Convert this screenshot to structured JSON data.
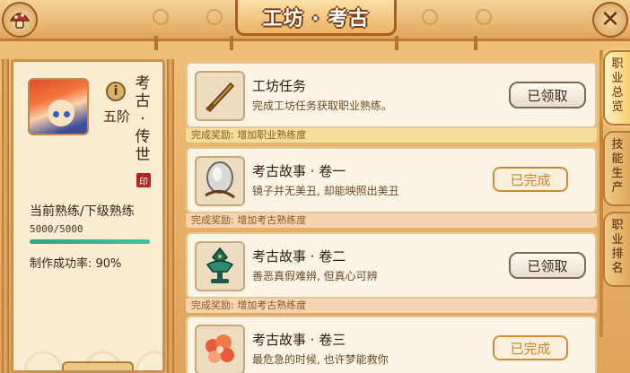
{
  "header": {
    "title": "工坊 · 考古",
    "close_icon": "close-icon",
    "home_icon": "mushroom-home-icon"
  },
  "profile": {
    "title": "考古 · 传世",
    "grade": "五阶",
    "info_label": "i",
    "seal_text": "印",
    "progress_label": "当前熟练/下级熟练",
    "progress_value": "5000/5000",
    "progress_fraction": 1.0,
    "success_rate": "制作成功率: 90%",
    "accent_color": "#2aa58a"
  },
  "tasks": [
    {
      "name": "工坊任务",
      "desc": "完成工坊任务获取职业熟练。",
      "reward": "完成奖励: 增加职业熟练度",
      "button": "已领取",
      "state": "claimed",
      "icon": "bronze-dagger-icon",
      "reward_bg": "#f1dd9c"
    },
    {
      "name": "考古故事 · 卷一",
      "desc": "镜子并无美丑, 却能映照出美丑",
      "reward": "完成奖励: 增加考古熟练度",
      "button": "已完成",
      "state": "done",
      "icon": "bronze-mirror-icon",
      "reward_bg": "#f6d4b2"
    },
    {
      "name": "考古故事 · 卷二",
      "desc": "善恶真假难辨, 但真心可辨",
      "reward": "完成奖励: 增加考古熟练度",
      "button": "已领取",
      "state": "claimed",
      "icon": "jade-lamp-icon",
      "reward_bg": "#f6d4b2"
    },
    {
      "name": "考古故事 · 卷三",
      "desc": "最危急的时候, 也许梦能救你",
      "reward": "",
      "button": "已完成",
      "state": "done",
      "icon": "red-cloud-relic-icon",
      "reward_bg": "#f6d4b2"
    }
  ],
  "tabs": [
    {
      "label": "职业总览",
      "active": true
    },
    {
      "label": "技能生产",
      "active": false
    },
    {
      "label": "职业排名",
      "active": false
    }
  ]
}
